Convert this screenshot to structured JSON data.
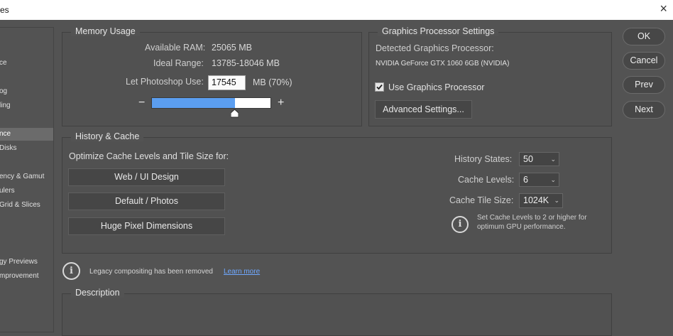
{
  "window": {
    "title": "es",
    "close_glyph": "×"
  },
  "sidebar": {
    "items": [
      {
        "label": "ce"
      },
      {
        "label": "og"
      },
      {
        "label": "ling"
      },
      {
        "label": "nce",
        "active": true
      },
      {
        "label": "Disks"
      },
      {
        "label": "ency & Gamut"
      },
      {
        "label": "ulers"
      },
      {
        "label": "Grid & Slices"
      },
      {
        "label": "gy Previews"
      },
      {
        "label": "mprovement"
      }
    ]
  },
  "memory": {
    "legend": "Memory Usage",
    "available_label": "Available RAM:",
    "available_value": "25065 MB",
    "ideal_label": "Ideal Range:",
    "ideal_value": "13785-18046 MB",
    "let_label": "Let Photoshop Use:",
    "let_value": "17545",
    "let_unit": "MB (70%)",
    "slider_minus": "−",
    "slider_plus": "+",
    "slider_fraction": 0.7,
    "slider_fill_color": "#5b9ef0"
  },
  "gpu": {
    "legend": "Graphics Processor Settings",
    "detected_label": "Detected Graphics Processor:",
    "detected_value": "NVIDIA GeForce GTX 1060 6GB (NVIDIA)",
    "use_label": "Use Graphics Processor",
    "use_checked": true,
    "advanced_button": "Advanced Settings..."
  },
  "actions": {
    "ok": "OK",
    "cancel": "Cancel",
    "prev": "Prev",
    "next": "Next"
  },
  "history": {
    "legend": "History & Cache",
    "optimize_label": "Optimize Cache Levels and Tile Size for:",
    "buttons": [
      "Web / UI Design",
      "Default / Photos",
      "Huge Pixel Dimensions"
    ],
    "states_label": "History States:",
    "states_value": "50",
    "levels_label": "Cache Levels:",
    "levels_value": "6",
    "tile_label": "Cache Tile Size:",
    "tile_value": "1024K",
    "tip_line1": "Set Cache Levels to 2 or higher for",
    "tip_line2": "optimum GPU performance."
  },
  "legacy": {
    "text": "Legacy compositing has been removed",
    "link": "Learn more"
  },
  "description": {
    "legend": "Description"
  }
}
